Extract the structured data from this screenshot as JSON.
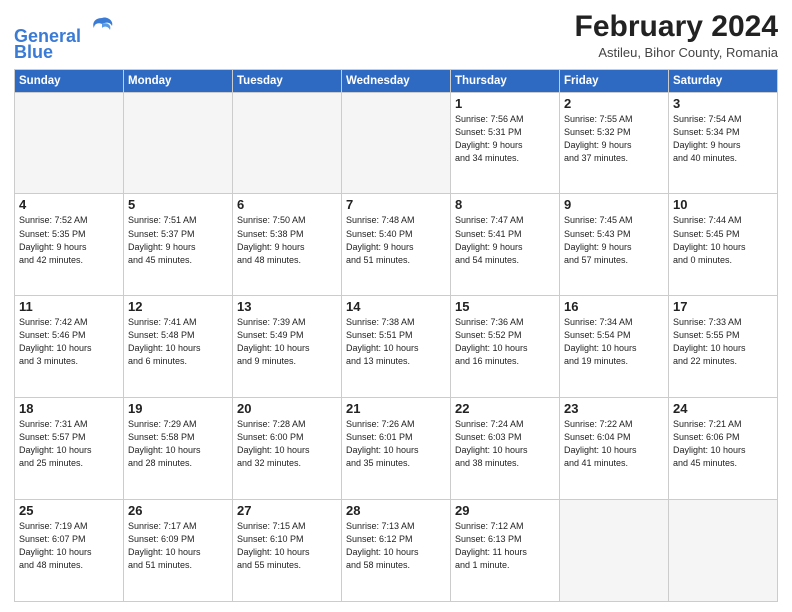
{
  "header": {
    "logo_line1": "General",
    "logo_line2": "Blue",
    "month_title": "February 2024",
    "location": "Astileu, Bihor County, Romania"
  },
  "weekdays": [
    "Sunday",
    "Monday",
    "Tuesday",
    "Wednesday",
    "Thursday",
    "Friday",
    "Saturday"
  ],
  "weeks": [
    [
      {
        "day": "",
        "info": ""
      },
      {
        "day": "",
        "info": ""
      },
      {
        "day": "",
        "info": ""
      },
      {
        "day": "",
        "info": ""
      },
      {
        "day": "1",
        "info": "Sunrise: 7:56 AM\nSunset: 5:31 PM\nDaylight: 9 hours\nand 34 minutes."
      },
      {
        "day": "2",
        "info": "Sunrise: 7:55 AM\nSunset: 5:32 PM\nDaylight: 9 hours\nand 37 minutes."
      },
      {
        "day": "3",
        "info": "Sunrise: 7:54 AM\nSunset: 5:34 PM\nDaylight: 9 hours\nand 40 minutes."
      }
    ],
    [
      {
        "day": "4",
        "info": "Sunrise: 7:52 AM\nSunset: 5:35 PM\nDaylight: 9 hours\nand 42 minutes."
      },
      {
        "day": "5",
        "info": "Sunrise: 7:51 AM\nSunset: 5:37 PM\nDaylight: 9 hours\nand 45 minutes."
      },
      {
        "day": "6",
        "info": "Sunrise: 7:50 AM\nSunset: 5:38 PM\nDaylight: 9 hours\nand 48 minutes."
      },
      {
        "day": "7",
        "info": "Sunrise: 7:48 AM\nSunset: 5:40 PM\nDaylight: 9 hours\nand 51 minutes."
      },
      {
        "day": "8",
        "info": "Sunrise: 7:47 AM\nSunset: 5:41 PM\nDaylight: 9 hours\nand 54 minutes."
      },
      {
        "day": "9",
        "info": "Sunrise: 7:45 AM\nSunset: 5:43 PM\nDaylight: 9 hours\nand 57 minutes."
      },
      {
        "day": "10",
        "info": "Sunrise: 7:44 AM\nSunset: 5:45 PM\nDaylight: 10 hours\nand 0 minutes."
      }
    ],
    [
      {
        "day": "11",
        "info": "Sunrise: 7:42 AM\nSunset: 5:46 PM\nDaylight: 10 hours\nand 3 minutes."
      },
      {
        "day": "12",
        "info": "Sunrise: 7:41 AM\nSunset: 5:48 PM\nDaylight: 10 hours\nand 6 minutes."
      },
      {
        "day": "13",
        "info": "Sunrise: 7:39 AM\nSunset: 5:49 PM\nDaylight: 10 hours\nand 9 minutes."
      },
      {
        "day": "14",
        "info": "Sunrise: 7:38 AM\nSunset: 5:51 PM\nDaylight: 10 hours\nand 13 minutes."
      },
      {
        "day": "15",
        "info": "Sunrise: 7:36 AM\nSunset: 5:52 PM\nDaylight: 10 hours\nand 16 minutes."
      },
      {
        "day": "16",
        "info": "Sunrise: 7:34 AM\nSunset: 5:54 PM\nDaylight: 10 hours\nand 19 minutes."
      },
      {
        "day": "17",
        "info": "Sunrise: 7:33 AM\nSunset: 5:55 PM\nDaylight: 10 hours\nand 22 minutes."
      }
    ],
    [
      {
        "day": "18",
        "info": "Sunrise: 7:31 AM\nSunset: 5:57 PM\nDaylight: 10 hours\nand 25 minutes."
      },
      {
        "day": "19",
        "info": "Sunrise: 7:29 AM\nSunset: 5:58 PM\nDaylight: 10 hours\nand 28 minutes."
      },
      {
        "day": "20",
        "info": "Sunrise: 7:28 AM\nSunset: 6:00 PM\nDaylight: 10 hours\nand 32 minutes."
      },
      {
        "day": "21",
        "info": "Sunrise: 7:26 AM\nSunset: 6:01 PM\nDaylight: 10 hours\nand 35 minutes."
      },
      {
        "day": "22",
        "info": "Sunrise: 7:24 AM\nSunset: 6:03 PM\nDaylight: 10 hours\nand 38 minutes."
      },
      {
        "day": "23",
        "info": "Sunrise: 7:22 AM\nSunset: 6:04 PM\nDaylight: 10 hours\nand 41 minutes."
      },
      {
        "day": "24",
        "info": "Sunrise: 7:21 AM\nSunset: 6:06 PM\nDaylight: 10 hours\nand 45 minutes."
      }
    ],
    [
      {
        "day": "25",
        "info": "Sunrise: 7:19 AM\nSunset: 6:07 PM\nDaylight: 10 hours\nand 48 minutes."
      },
      {
        "day": "26",
        "info": "Sunrise: 7:17 AM\nSunset: 6:09 PM\nDaylight: 10 hours\nand 51 minutes."
      },
      {
        "day": "27",
        "info": "Sunrise: 7:15 AM\nSunset: 6:10 PM\nDaylight: 10 hours\nand 55 minutes."
      },
      {
        "day": "28",
        "info": "Sunrise: 7:13 AM\nSunset: 6:12 PM\nDaylight: 10 hours\nand 58 minutes."
      },
      {
        "day": "29",
        "info": "Sunrise: 7:12 AM\nSunset: 6:13 PM\nDaylight: 11 hours\nand 1 minute."
      },
      {
        "day": "",
        "info": ""
      },
      {
        "day": "",
        "info": ""
      }
    ]
  ]
}
